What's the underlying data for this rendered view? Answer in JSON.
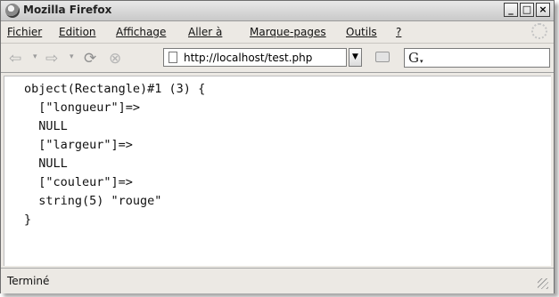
{
  "window": {
    "title": "Mozilla Firefox",
    "controls": {
      "minimize": "_",
      "maximize": "□",
      "close": "×"
    }
  },
  "menu": [
    "Fichier",
    "Edition",
    "Affichage",
    "Aller à",
    "Marque-pages",
    "Outils",
    "?"
  ],
  "navigation": {
    "back_icon": "back-arrow-icon",
    "forward_icon": "forward-arrow-icon",
    "reload_icon": "reload-icon",
    "stop_icon": "stop-icon",
    "address": "http://localhost/test.php",
    "search_engine_logo": "G"
  },
  "content": {
    "lines": [
      "object(Rectangle)#1 (3) {",
      "  [\"longueur\"]=>",
      "  NULL",
      "  [\"largeur\"]=>",
      "  NULL",
      "  [\"couleur\"]=>",
      "  string(5) \"rouge\"",
      "}"
    ]
  },
  "status": {
    "text": "Terminé"
  }
}
